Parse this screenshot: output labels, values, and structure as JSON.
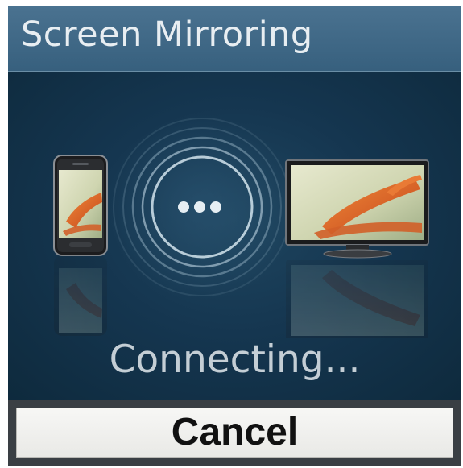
{
  "dialog": {
    "title": "Screen Mirroring",
    "status": "Connecting...",
    "cancel_label": "Cancel"
  },
  "illustration": {
    "source_device_icon": "smartphone-icon",
    "target_device_icon": "tv-icon",
    "connection_indicator_icon": "signal-dots-icon"
  },
  "colors": {
    "title_bar": "#3e6886",
    "content_background": "#0f2b3d",
    "status_text": "#c4ced5",
    "button_background": "#f2f2f0"
  }
}
